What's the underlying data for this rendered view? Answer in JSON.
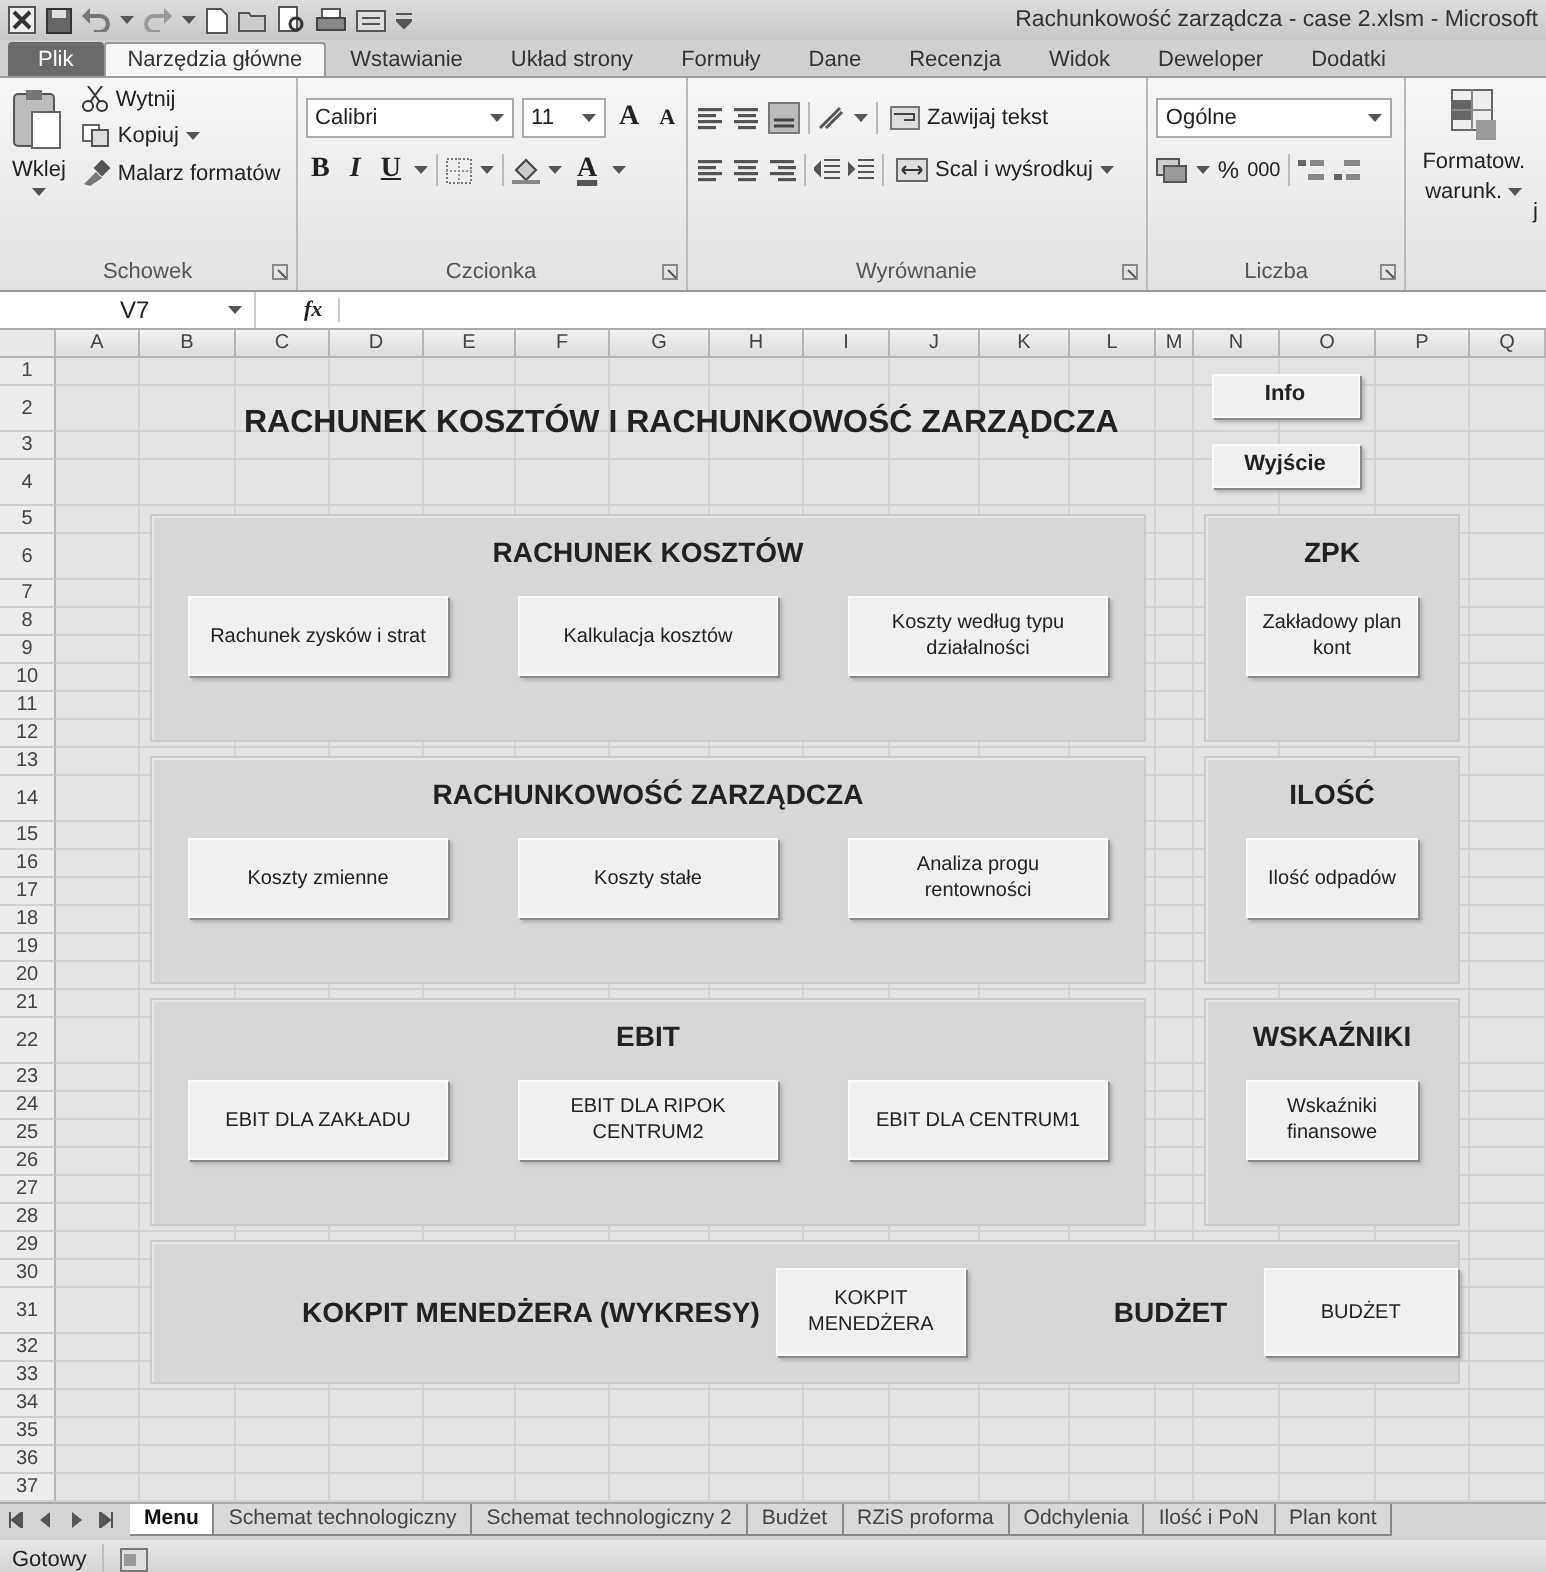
{
  "window": {
    "title": "Rachunkowość zarządcza - case 2.xlsm  -  Microsoft"
  },
  "ribbon_tabs": [
    {
      "label": "Plik",
      "kind": "file",
      "selected": false
    },
    {
      "label": "Narzędzia główne",
      "kind": "tab",
      "selected": true
    },
    {
      "label": "Wstawianie",
      "kind": "tab",
      "selected": false
    },
    {
      "label": "Układ strony",
      "kind": "tab",
      "selected": false
    },
    {
      "label": "Formuły",
      "kind": "tab",
      "selected": false
    },
    {
      "label": "Dane",
      "kind": "tab",
      "selected": false
    },
    {
      "label": "Recenzja",
      "kind": "tab",
      "selected": false
    },
    {
      "label": "Widok",
      "kind": "tab",
      "selected": false
    },
    {
      "label": "Deweloper",
      "kind": "tab",
      "selected": false
    },
    {
      "label": "Dodatki",
      "kind": "tab",
      "selected": false
    }
  ],
  "clipboard": {
    "paste": "Wklej",
    "cut": "Wytnij",
    "copy": "Kopiuj",
    "painter": "Malarz formatów",
    "label": "Schowek"
  },
  "font": {
    "family": "Calibri",
    "size": "11",
    "grow": "A",
    "shrink": "A",
    "bold": "B",
    "italic": "I",
    "underline": "U",
    "font_color_letter": "A",
    "label": "Czcionka"
  },
  "alignment": {
    "wrap": "Zawijaj tekst",
    "merge": "Scal i wyśrodkuj",
    "label": "Wyrównanie"
  },
  "number": {
    "format": "Ogólne",
    "percent": "%",
    "thousands": "000",
    "label": "Liczba"
  },
  "styles": {
    "conditional": [
      "Formatow.",
      "warunk."
    ],
    "cut_text": "j"
  },
  "formula_bar": {
    "cell": "V7",
    "fx": "fx"
  },
  "columns": [
    "A",
    "B",
    "C",
    "D",
    "E",
    "F",
    "G",
    "H",
    "I",
    "J",
    "K",
    "L",
    "M",
    "N",
    "O",
    "P",
    "Q"
  ],
  "rows": [
    "1",
    "2",
    "3",
    "4",
    "5",
    "6",
    "7",
    "8",
    "9",
    "10",
    "11",
    "12",
    "13",
    "14",
    "15",
    "16",
    "17",
    "18",
    "19",
    "20",
    "21",
    "22",
    "23",
    "24",
    "25",
    "26",
    "27",
    "28",
    "29",
    "30",
    "31",
    "32",
    "33",
    "34",
    "35",
    "36",
    "37"
  ],
  "sheet": {
    "title": "RACHUNEK KOSZTÓW I RACHUNKOWOŚĆ ZARZĄDCZA",
    "top_buttons": [
      "Info",
      "Wyjście"
    ],
    "panels": [
      {
        "kind": "stacked",
        "heading": "RACHUNEK KOSZTÓW",
        "buttons": [
          "Rachunek zysków i strat",
          "Kalkulacja kosztów",
          "Koszty według typu działalności"
        ]
      },
      {
        "kind": "stacked",
        "heading": "ZPK",
        "buttons": [
          "Zakładowy plan kont"
        ]
      },
      {
        "kind": "stacked",
        "heading": "RACHUNKOWOŚĆ ZARZĄDCZA",
        "buttons": [
          "Koszty zmienne",
          "Koszty stałe",
          "Analiza progu rentowności"
        ]
      },
      {
        "kind": "stacked",
        "heading": "ILOŚĆ",
        "buttons": [
          "Ilość odpadów"
        ]
      },
      {
        "kind": "stacked",
        "heading": "EBIT",
        "buttons": [
          "EBIT DLA ZAKŁADU",
          "EBIT DLA RIPOK CENTRUM2",
          "EBIT DLA CENTRUM1"
        ]
      },
      {
        "kind": "stacked",
        "heading": "WSKAŹNIKI",
        "buttons": [
          "Wskaźniki finansowe"
        ]
      },
      {
        "kind": "inline",
        "items": [
          {
            "kind": "label",
            "text": "KOKPIT MENEDŻERA (WYKRESY)"
          },
          {
            "kind": "button",
            "text": "KOKPIT MENEDŻERA"
          },
          {
            "kind": "label",
            "text": "BUDŻET"
          },
          {
            "kind": "button",
            "text": "BUDŻET"
          }
        ]
      }
    ]
  },
  "sheet_tabs": [
    {
      "label": "Menu",
      "selected": true
    },
    {
      "label": "Schemat technologiczny",
      "selected": false
    },
    {
      "label": "Schemat technologiczny 2",
      "selected": false
    },
    {
      "label": "Budżet",
      "selected": false
    },
    {
      "label": "RZiS proforma",
      "selected": false
    },
    {
      "label": "Odchylenia",
      "selected": false
    },
    {
      "label": "Ilość i PoN",
      "selected": false
    },
    {
      "label": "Plan kont",
      "selected": false
    }
  ],
  "status_bar": {
    "text": "Gotowy"
  }
}
